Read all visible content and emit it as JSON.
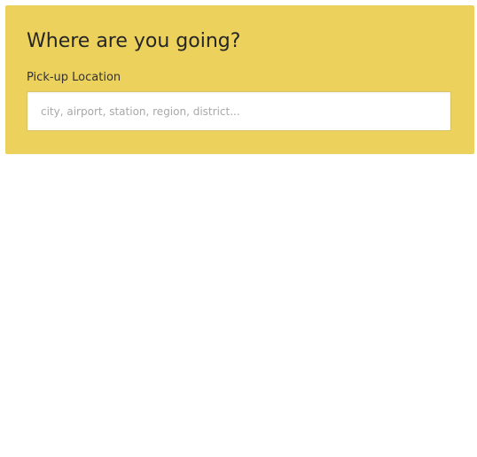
{
  "search": {
    "title": "Where are you going?",
    "pickup_label": "Pick-up Location",
    "pickup_value": "",
    "pickup_placeholder": "city, airport, station, region, district..."
  },
  "colors": {
    "panel_background": "#ecd15c",
    "page_background": "#ffffff",
    "input_background": "#ffffff"
  }
}
